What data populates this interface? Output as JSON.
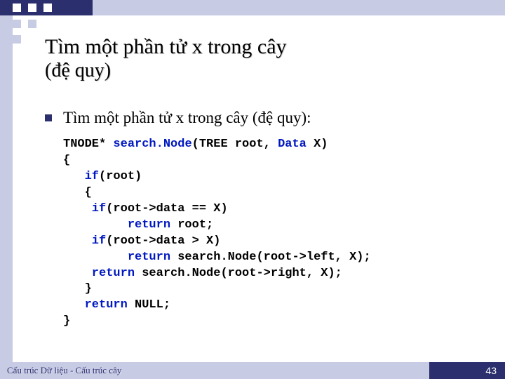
{
  "title_line1": "Tìm một phần tử x trong cây",
  "title_line2": "(đệ quy)",
  "bullet_text": "Tìm một phần tử x trong cây (đệ quy):",
  "code": {
    "l1a": "TNODE* ",
    "l1b": "search.Node",
    "l1c": "(TREE root, ",
    "l1d": "Data",
    "l1e": " X)",
    "l2": "{",
    "l3a": "   if",
    "l3b": "(root)",
    "l4": "   {",
    "l5a": "    if",
    "l5b": "(root->data == X)",
    "l6a": "         return",
    "l6b": " root;",
    "l7a": "    if",
    "l7b": "(root->data > X)",
    "l8a": "         return",
    "l8b": " search.Node(root->left, X);",
    "l9a": "    return",
    "l9b": " search.Node(root->right, X);",
    "l10": "   }",
    "l11a": "   return",
    "l11b": " NULL;",
    "l12": "}"
  },
  "footer_text": "Cấu trúc Dữ liệu - Cấu trúc cây",
  "page_number": "43"
}
